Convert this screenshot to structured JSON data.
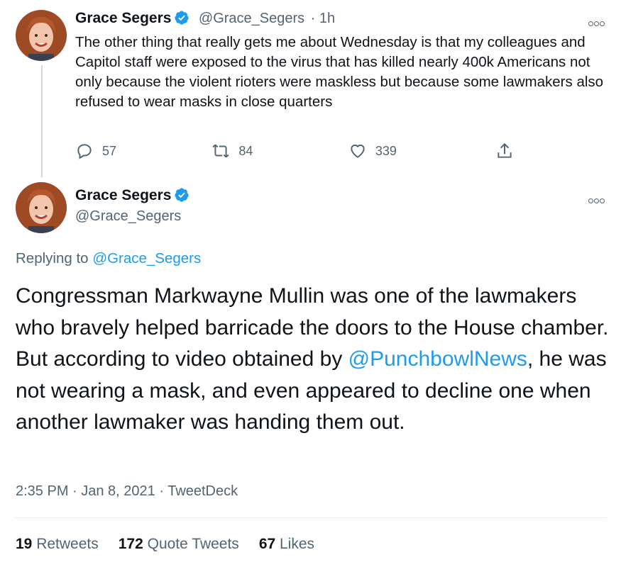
{
  "first_tweet": {
    "name": "Grace Segers",
    "handle": "@Grace_Segers",
    "time": "· 1h",
    "text": "The other thing that really gets me about Wednesday is that my colleagues and Capitol staff were exposed to the virus that has killed nearly 400k Americans not only because the violent rioters were maskless but because some lawmakers also refused to wear masks in close quarters",
    "replies": "57",
    "retweets": "84",
    "likes": "339"
  },
  "main_tweet": {
    "name": "Grace Segers",
    "handle": "@Grace_Segers",
    "replying_prefix": "Replying to ",
    "replying_handle": "@Grace_Segers",
    "text_part1": "Congressman Markwayne Mullin was one of the lawmakers who bravely helped barricade the doors to the House chamber. But according to video obtained by ",
    "mention": "@PunchbowlNews",
    "text_part2": ", he was not wearing a mask, and even appeared to decline one when another lawmaker was handing them out.",
    "timestamp": "2:35 PM · Jan 8, 2021 · TweetDeck"
  },
  "stats": {
    "retweets_count": "19",
    "retweets_label": " Retweets",
    "quotes_count": "172",
    "quotes_label": " Quote Tweets",
    "likes_count": "67",
    "likes_label": " Likes"
  },
  "icons": {
    "verified": "verified-badge-icon",
    "more": "more-options-icon",
    "reply": "reply-icon",
    "retweet": "retweet-icon",
    "like": "heart-icon",
    "share": "share-icon"
  },
  "colors": {
    "link": "#1d9bf0",
    "secondary": "#536471",
    "primary_text": "#0f1419"
  }
}
